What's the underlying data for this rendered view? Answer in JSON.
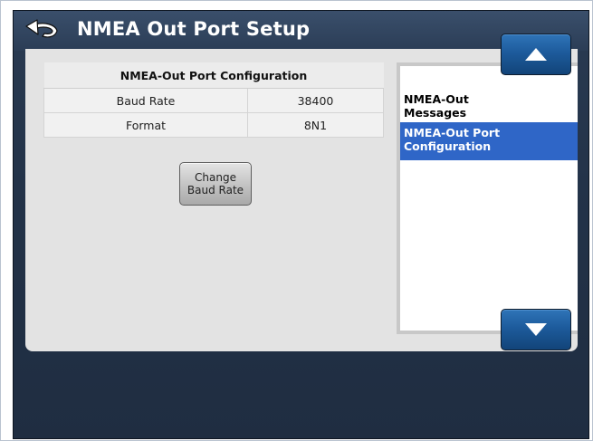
{
  "header": {
    "title": "NMEA Out Port Setup",
    "back_icon": "back-arrow-icon"
  },
  "config_table": {
    "heading": "NMEA-Out Port Configuration",
    "rows": [
      {
        "label": "Baud Rate",
        "value": "38400"
      },
      {
        "label": "Format",
        "value": "8N1"
      }
    ]
  },
  "change_button": {
    "line1": "Change",
    "line2": "Baud Rate"
  },
  "side_list": {
    "items": [
      {
        "line1": "NMEA-Out",
        "line2": "Messages",
        "selected": false
      },
      {
        "line1": "NMEA-Out Port",
        "line2": "Configuration",
        "selected": true
      }
    ]
  },
  "scroll": {
    "up_icon": "triangle-up-icon",
    "down_icon": "triangle-down-icon"
  },
  "colors": {
    "title_bar": "#2b3d56",
    "panel": "#e3e3e3",
    "selected_item": "#2f66c7",
    "scroll_button": "#1d5b9c"
  }
}
